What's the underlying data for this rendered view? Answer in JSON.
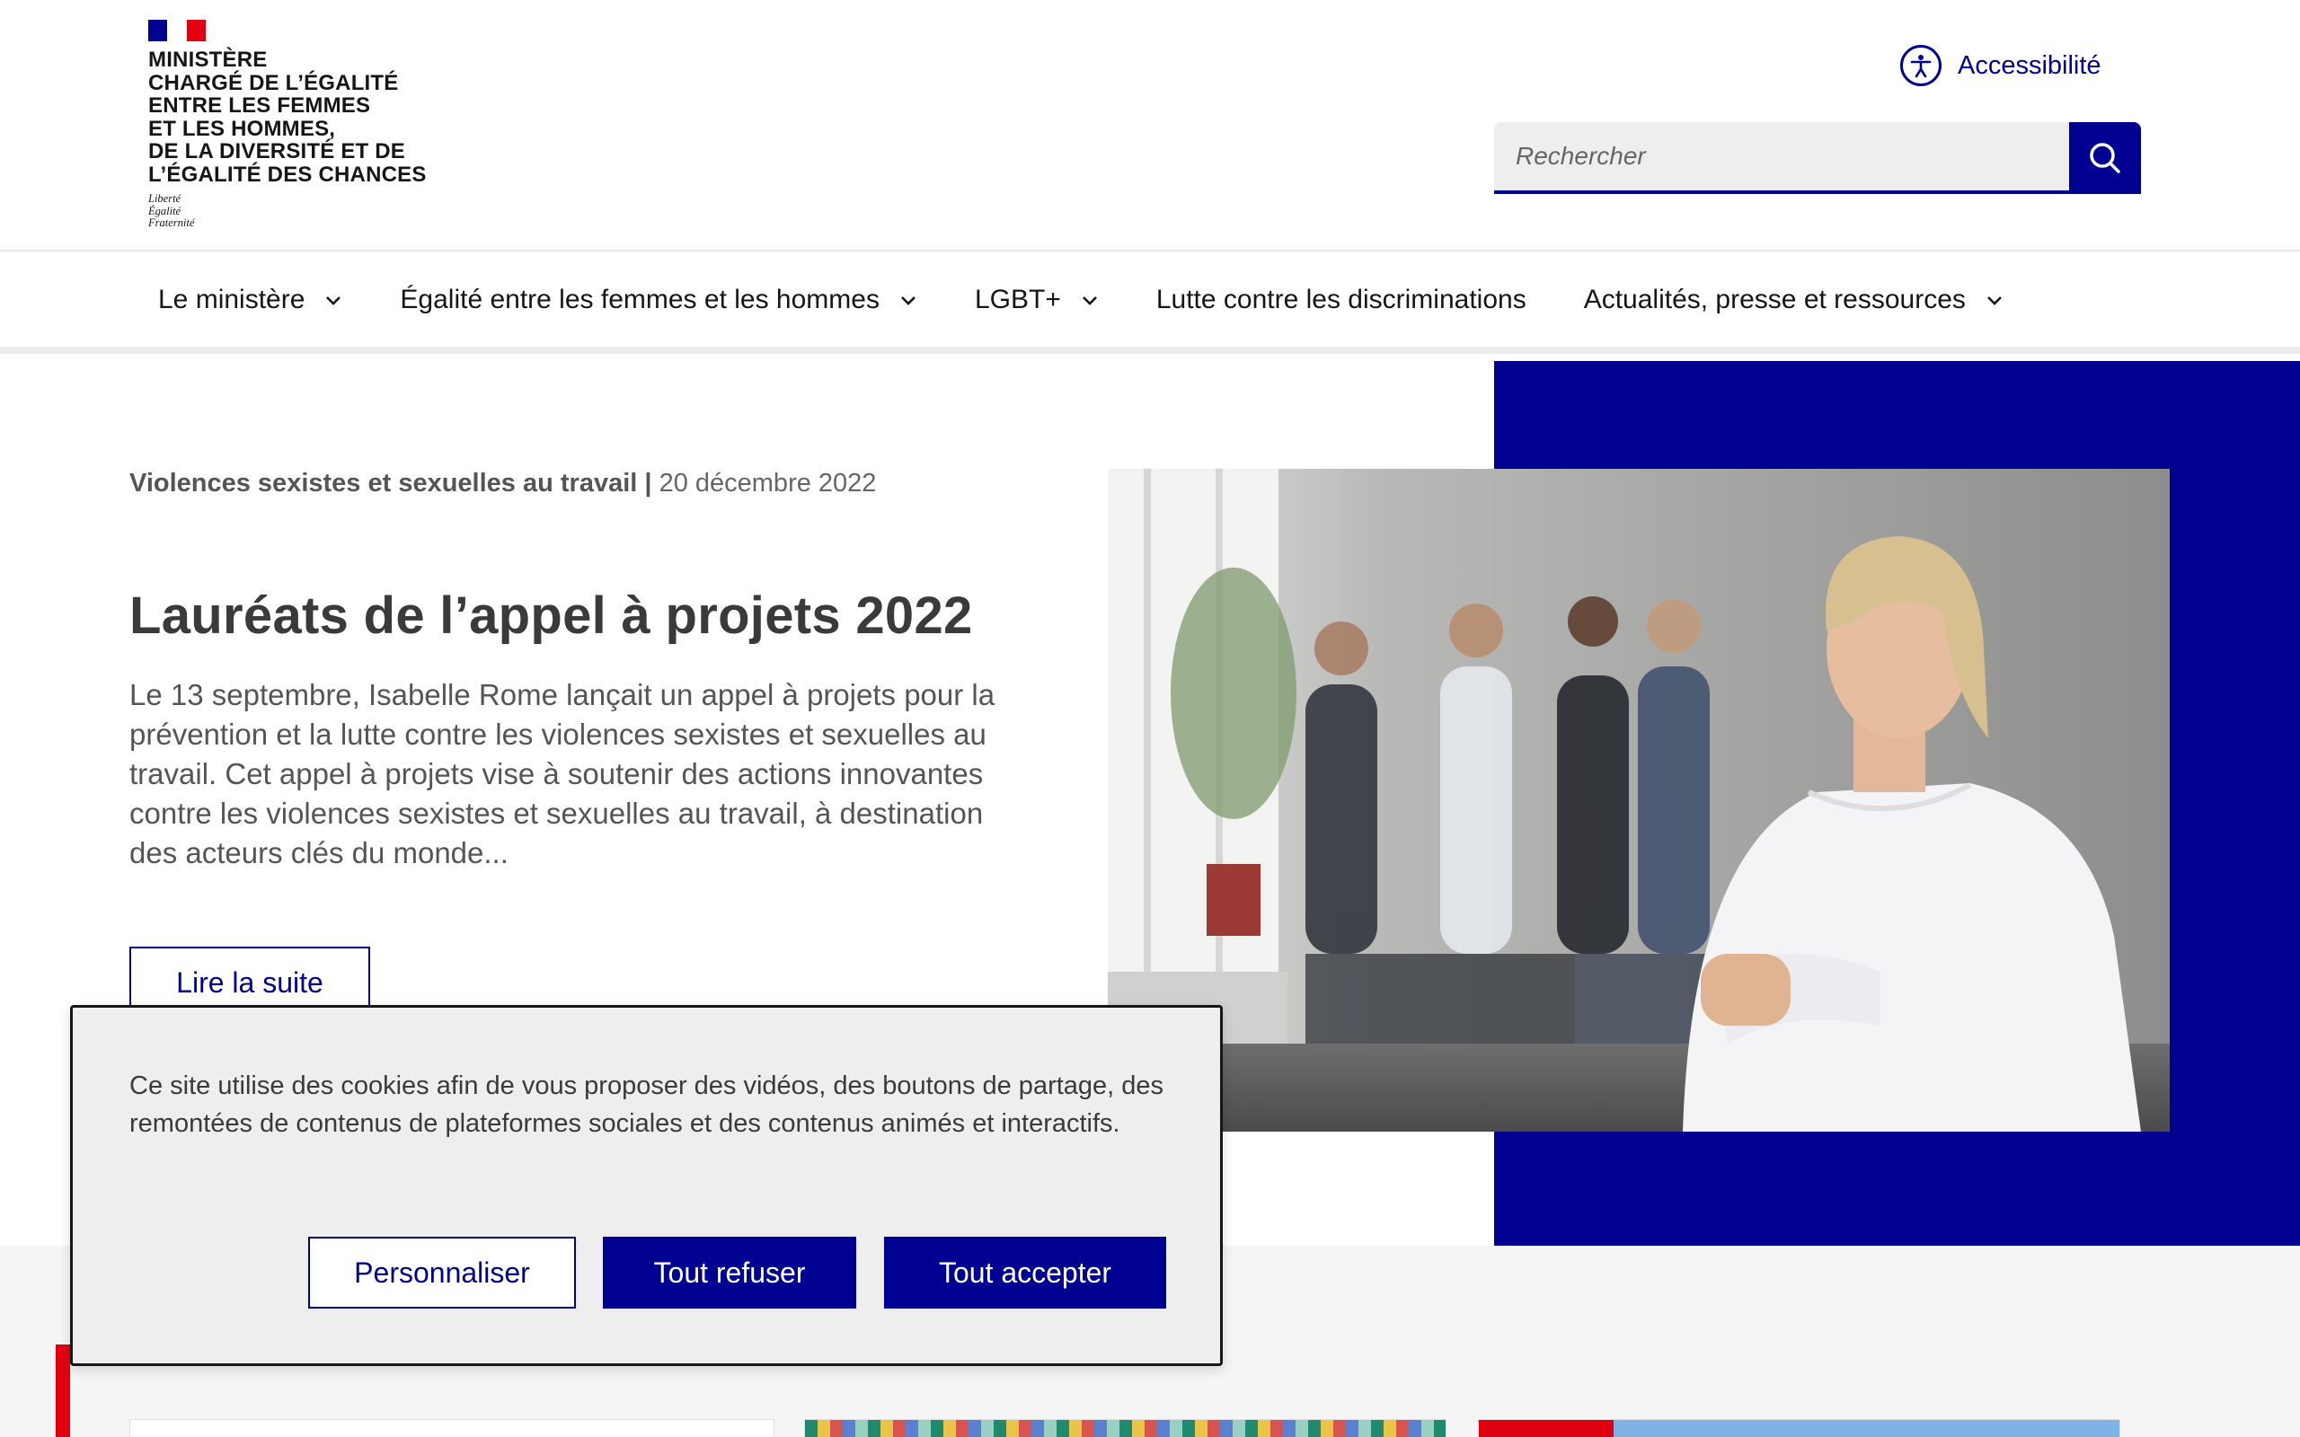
{
  "header": {
    "flag_colors": [
      "#000091",
      "#ffffff",
      "#e1000f"
    ],
    "ministry_lines": [
      "MINISTÈRE",
      "CHARGÉ DE L’ÉGALITÉ",
      "ENTRE LES FEMMES",
      "ET LES HOMMES,",
      "DE LA DIVERSITÉ ET DE",
      "L’ÉGALITÉ DES CHANCES"
    ],
    "motto": [
      "Liberté",
      "Égalité",
      "Fraternité"
    ],
    "accessibility_label": "Accessibilité",
    "accessibility_icon": "accessibility-icon",
    "search_placeholder": "Rechercher",
    "search_icon": "search-icon"
  },
  "nav": {
    "items": [
      {
        "label": "Le ministère",
        "has_dropdown": true
      },
      {
        "label": "Égalité entre les femmes et les hommes",
        "has_dropdown": true
      },
      {
        "label": "LGBT+",
        "has_dropdown": true
      },
      {
        "label": "Lutte contre les discriminations",
        "has_dropdown": false
      },
      {
        "label": "Actualités, presse et ressources",
        "has_dropdown": true
      }
    ]
  },
  "hero": {
    "category": "Violences sexistes et sexuelles au travail",
    "separator": "|",
    "date": "20 décembre 2022",
    "title": "Lauréats de l’appel à projets 2022",
    "text": "Le 13 septembre, Isabelle Rome lançait un appel à projets pour la prévention et la lutte contre les violences sexistes et sexuelles au travail. Cet appel à projets vise à soutenir des actions innovantes contre les violences sexistes et sexuelles au travail, à destination des acteurs clés du monde...",
    "read_more": "Lire la suite"
  },
  "cookie": {
    "text": "Ce site utilise des cookies afin de vous proposer des vidéos, des boutons de partage, des remontées de contenus de plateformes sociales et des contenus animés et interactifs.",
    "customize_label": "Personnaliser",
    "refuse_label": "Tout refuser",
    "accept_label": "Tout accepter"
  },
  "colors": {
    "brand_blue": "#000091",
    "marianne_red": "#e1000f",
    "text_dark": "#3a3a3a"
  }
}
